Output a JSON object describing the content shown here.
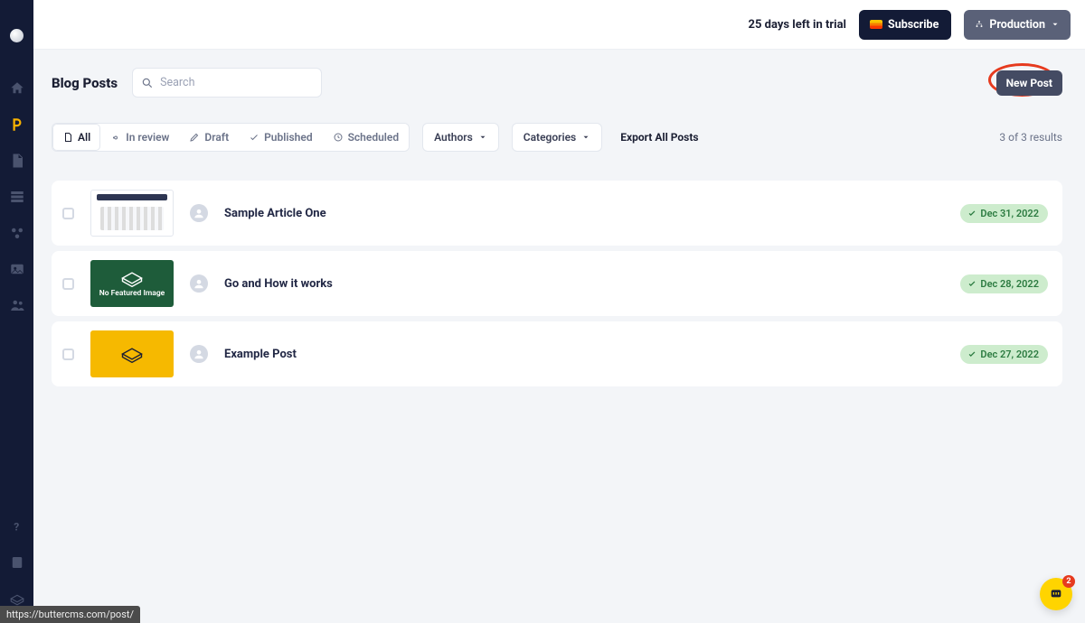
{
  "topbar": {
    "trial_text": "25 days left in trial",
    "subscribe_label": "Subscribe",
    "env_label": "Production"
  },
  "page": {
    "title": "Blog Posts",
    "search_placeholder": "Search",
    "new_post_label": "New Post"
  },
  "filters": {
    "all": "All",
    "in_review": "In review",
    "draft": "Draft",
    "published": "Published",
    "scheduled": "Scheduled",
    "authors_label": "Authors",
    "categories_label": "Categories",
    "export_label": "Export All Posts",
    "results_text": "3 of 3 results"
  },
  "posts": [
    {
      "title": "Sample Article One",
      "date": "Dec 31, 2022",
      "thumb": "t1",
      "no_featured_label": ""
    },
    {
      "title": "Go and How it works",
      "date": "Dec 28, 2022",
      "thumb": "t2",
      "no_featured_label": "No Featured Image"
    },
    {
      "title": "Example Post",
      "date": "Dec 27, 2022",
      "thumb": "t3",
      "no_featured_label": ""
    }
  ],
  "footer": {
    "url_hint": "https://buttercms.com/post/"
  },
  "intercom": {
    "badge": "2"
  }
}
